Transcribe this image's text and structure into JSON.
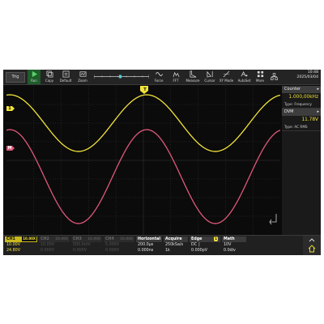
{
  "toolbar": {
    "trig_label": "Trig",
    "buttons": [
      {
        "label": "Run",
        "icon": "play-icon"
      },
      {
        "label": "Copy",
        "icon": "copy-icon"
      },
      {
        "label": "Default",
        "icon": "default-icon"
      },
      {
        "label": "Zoom",
        "icon": "zoom-icon"
      },
      {
        "label": "Force",
        "icon": "force-icon"
      },
      {
        "label": "FFT",
        "icon": "fft-icon"
      },
      {
        "label": "Measure",
        "icon": "measure-icon"
      },
      {
        "label": "Cursor",
        "icon": "cursor-icon"
      },
      {
        "label": "XY Mode",
        "icon": "xy-mode-icon"
      },
      {
        "label": "AutoSet",
        "icon": "autoset-icon"
      },
      {
        "label": "More",
        "icon": "more-icon"
      }
    ],
    "time": "10:48",
    "date": "2025/03/04"
  },
  "right_panel": {
    "counter_label": "Counter",
    "counter_value": "1.000,00kHz",
    "counter_type": "Type: Frequency",
    "dvm_label": "DVM",
    "dvm_value": "11.78V",
    "dvm_type": "Type: AC RMS"
  },
  "channels": {
    "ch1": {
      "name": "CH1",
      "tag": "10.00X",
      "scale": "10.00V",
      "offset": "24.80V"
    },
    "ch2": {
      "name": "CH2",
      "tag": "10.00X",
      "scale": "10.00V",
      "offset": "0.000V"
    },
    "ch3": {
      "name": "CH3",
      "tag": "10.00X",
      "scale": "500.0mV",
      "offset": "0.000V"
    },
    "ch4": {
      "name": "CH4",
      "tag": "10.00X",
      "scale": "5.000V",
      "offset": "0.000V"
    }
  },
  "horizontal": {
    "title": "Horizontal",
    "timebase": "200.0µs",
    "delay": "0.000ns"
  },
  "acquire": {
    "title": "Acquire",
    "rate": "250kSa/s",
    "depth": "1k"
  },
  "edge": {
    "title": "Edge",
    "source": "1",
    "coupling": "DC",
    "level": "0.000pV"
  },
  "math": {
    "title": "Math",
    "scale": "10V",
    "offset": "0.0div"
  },
  "markers": {
    "ch1": "1",
    "math": "M",
    "trigger": "T"
  },
  "colors": {
    "ch1": "#f2e33a",
    "math": "#e0587a",
    "grid": "#3a3a3a"
  },
  "waveforms": {
    "ch1": {
      "frequency_khz": 1.0,
      "amplitude_div": 1.9
    },
    "math": {
      "frequency_khz": 1.0,
      "amplitude_div": 3.5
    }
  }
}
